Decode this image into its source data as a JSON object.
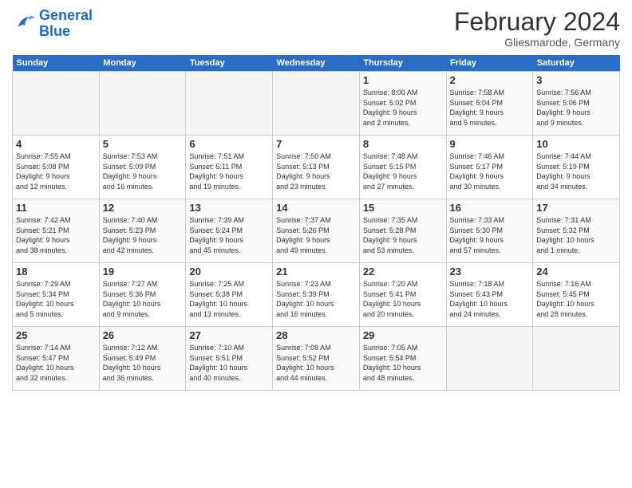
{
  "header": {
    "logo_line1": "General",
    "logo_line2": "Blue",
    "title": "February 2024",
    "subtitle": "Gliesmarode, Germany"
  },
  "days_of_week": [
    "Sunday",
    "Monday",
    "Tuesday",
    "Wednesday",
    "Thursday",
    "Friday",
    "Saturday"
  ],
  "weeks": [
    [
      {
        "day": "",
        "info": ""
      },
      {
        "day": "",
        "info": ""
      },
      {
        "day": "",
        "info": ""
      },
      {
        "day": "",
        "info": ""
      },
      {
        "day": "1",
        "info": "Sunrise: 8:00 AM\nSunset: 5:02 PM\nDaylight: 9 hours\nand 2 minutes."
      },
      {
        "day": "2",
        "info": "Sunrise: 7:58 AM\nSunset: 5:04 PM\nDaylight: 9 hours\nand 5 minutes."
      },
      {
        "day": "3",
        "info": "Sunrise: 7:56 AM\nSunset: 5:06 PM\nDaylight: 9 hours\nand 9 minutes."
      }
    ],
    [
      {
        "day": "4",
        "info": "Sunrise: 7:55 AM\nSunset: 5:08 PM\nDaylight: 9 hours\nand 12 minutes."
      },
      {
        "day": "5",
        "info": "Sunrise: 7:53 AM\nSunset: 5:09 PM\nDaylight: 9 hours\nand 16 minutes."
      },
      {
        "day": "6",
        "info": "Sunrise: 7:51 AM\nSunset: 5:11 PM\nDaylight: 9 hours\nand 19 minutes."
      },
      {
        "day": "7",
        "info": "Sunrise: 7:50 AM\nSunset: 5:13 PM\nDaylight: 9 hours\nand 23 minutes."
      },
      {
        "day": "8",
        "info": "Sunrise: 7:48 AM\nSunset: 5:15 PM\nDaylight: 9 hours\nand 27 minutes."
      },
      {
        "day": "9",
        "info": "Sunrise: 7:46 AM\nSunset: 5:17 PM\nDaylight: 9 hours\nand 30 minutes."
      },
      {
        "day": "10",
        "info": "Sunrise: 7:44 AM\nSunset: 5:19 PM\nDaylight: 9 hours\nand 34 minutes."
      }
    ],
    [
      {
        "day": "11",
        "info": "Sunrise: 7:42 AM\nSunset: 5:21 PM\nDaylight: 9 hours\nand 38 minutes."
      },
      {
        "day": "12",
        "info": "Sunrise: 7:40 AM\nSunset: 5:23 PM\nDaylight: 9 hours\nand 42 minutes."
      },
      {
        "day": "13",
        "info": "Sunrise: 7:39 AM\nSunset: 5:24 PM\nDaylight: 9 hours\nand 45 minutes."
      },
      {
        "day": "14",
        "info": "Sunrise: 7:37 AM\nSunset: 5:26 PM\nDaylight: 9 hours\nand 49 minutes."
      },
      {
        "day": "15",
        "info": "Sunrise: 7:35 AM\nSunset: 5:28 PM\nDaylight: 9 hours\nand 53 minutes."
      },
      {
        "day": "16",
        "info": "Sunrise: 7:33 AM\nSunset: 5:30 PM\nDaylight: 9 hours\nand 57 minutes."
      },
      {
        "day": "17",
        "info": "Sunrise: 7:31 AM\nSunset: 5:32 PM\nDaylight: 10 hours\nand 1 minute."
      }
    ],
    [
      {
        "day": "18",
        "info": "Sunrise: 7:29 AM\nSunset: 5:34 PM\nDaylight: 10 hours\nand 5 minutes."
      },
      {
        "day": "19",
        "info": "Sunrise: 7:27 AM\nSunset: 5:36 PM\nDaylight: 10 hours\nand 9 minutes."
      },
      {
        "day": "20",
        "info": "Sunrise: 7:25 AM\nSunset: 5:38 PM\nDaylight: 10 hours\nand 13 minutes."
      },
      {
        "day": "21",
        "info": "Sunrise: 7:23 AM\nSunset: 5:39 PM\nDaylight: 10 hours\nand 16 minutes."
      },
      {
        "day": "22",
        "info": "Sunrise: 7:20 AM\nSunset: 5:41 PM\nDaylight: 10 hours\nand 20 minutes."
      },
      {
        "day": "23",
        "info": "Sunrise: 7:18 AM\nSunset: 5:43 PM\nDaylight: 10 hours\nand 24 minutes."
      },
      {
        "day": "24",
        "info": "Sunrise: 7:16 AM\nSunset: 5:45 PM\nDaylight: 10 hours\nand 28 minutes."
      }
    ],
    [
      {
        "day": "25",
        "info": "Sunrise: 7:14 AM\nSunset: 5:47 PM\nDaylight: 10 hours\nand 32 minutes."
      },
      {
        "day": "26",
        "info": "Sunrise: 7:12 AM\nSunset: 5:49 PM\nDaylight: 10 hours\nand 36 minutes."
      },
      {
        "day": "27",
        "info": "Sunrise: 7:10 AM\nSunset: 5:51 PM\nDaylight: 10 hours\nand 40 minutes."
      },
      {
        "day": "28",
        "info": "Sunrise: 7:08 AM\nSunset: 5:52 PM\nDaylight: 10 hours\nand 44 minutes."
      },
      {
        "day": "29",
        "info": "Sunrise: 7:05 AM\nSunset: 5:54 PM\nDaylight: 10 hours\nand 48 minutes."
      },
      {
        "day": "",
        "info": ""
      },
      {
        "day": "",
        "info": ""
      }
    ]
  ]
}
